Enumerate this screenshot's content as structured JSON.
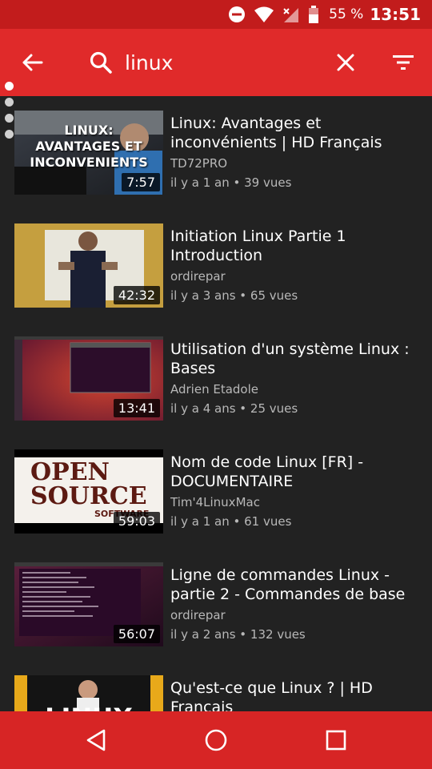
{
  "status_bar": {
    "battery_percent": "55 %",
    "time": "13:51"
  },
  "toolbar": {
    "search_value": "linux",
    "icons": [
      "back-arrow-icon",
      "search-icon",
      "close-icon",
      "filter-icon"
    ]
  },
  "results": [
    {
      "title": "Linux: Avantages et inconvénients | HD Français",
      "channel": "TD72PRO",
      "stats": "il y a 1 an • 39 vues",
      "duration": "7:57",
      "thumb_text": [
        "LINUX:",
        "AVANTAGES ET",
        "INCONVENIENTS"
      ]
    },
    {
      "title": "Initiation Linux Partie 1 Introduction",
      "channel": "ordirepar",
      "stats": "il y a 3 ans • 65 vues",
      "duration": "42:32"
    },
    {
      "title": "Utilisation d'un système Linux : Bases",
      "channel": "Adrien Etadole",
      "stats": "il y a 4 ans • 25 vues",
      "duration": "13:41"
    },
    {
      "title": "Nom de code Linux [FR] - DOCUMENTAIRE",
      "channel": "Tim'4LinuxMac",
      "stats": "il y a 1 an • 61 vues",
      "duration": "59:03",
      "thumb_text": [
        "OPEN",
        "SOURCE",
        "SOFTWARE"
      ]
    },
    {
      "title": "Ligne de commandes Linux - partie 2 - Commandes de base",
      "channel": "ordirepar",
      "stats": "il y a 2 ans • 132 vues",
      "duration": "56:07"
    },
    {
      "title": "Qu'est-ce que Linux ? | HD Français",
      "channel": "",
      "stats": "",
      "duration": "",
      "thumb_text": [
        "LINUX"
      ]
    }
  ],
  "colors": {
    "status_bar": "#c21c1c",
    "toolbar": "#e02a2a",
    "background": "#222222",
    "nav_bar": "#d72525"
  }
}
